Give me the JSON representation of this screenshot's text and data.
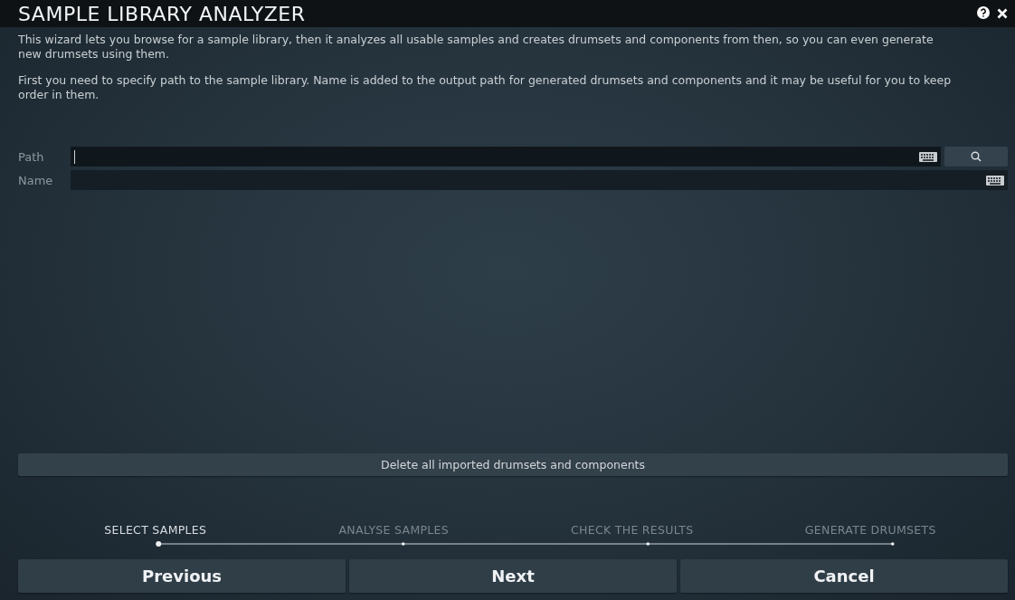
{
  "window": {
    "title": "SAMPLE LIBRARY ANALYZER"
  },
  "description": [
    "This wizard lets you browse for a sample library, then it analyzes all usable samples and creates drumsets and components from then, so you can even generate new drumsets using them.",
    "First you need to specify path to the sample library. Name is added to the output path for generated drumsets and components and it may be useful for you to keep order in them."
  ],
  "fields": [
    {
      "label": "Path",
      "kind": "browse",
      "focused": true
    },
    {
      "label": "Name",
      "kind": "plain",
      "focused": false
    }
  ],
  "delete_button": "Delete all imported drumsets and components",
  "steps": [
    {
      "label": "SELECT SAMPLES",
      "selected": true
    },
    {
      "label": "ANALYSE SAMPLES",
      "selected": false
    },
    {
      "label": "CHECK THE RESULTS",
      "selected": false
    },
    {
      "label": "GENERATE DRUMSETS",
      "selected": false
    }
  ],
  "buttons": [
    "Previous",
    "Next",
    "Cancel"
  ]
}
